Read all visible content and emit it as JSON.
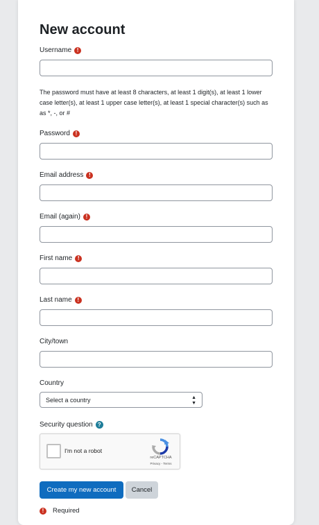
{
  "page": {
    "title": "New account",
    "password_hint": "The password must have at least 8 characters, at least 1 digit(s), at least 1 lower case letter(s), at least 1 upper case letter(s), at least 1 special character(s) such as as *, -, or #"
  },
  "fields": {
    "username": {
      "label": "Username",
      "value": ""
    },
    "password": {
      "label": "Password",
      "value": ""
    },
    "email": {
      "label": "Email address",
      "value": ""
    },
    "email_again": {
      "label": "Email (again)",
      "value": ""
    },
    "first_name": {
      "label": "First name",
      "value": ""
    },
    "last_name": {
      "label": "Last name",
      "value": ""
    },
    "city": {
      "label": "City/town",
      "value": ""
    },
    "country": {
      "label": "Country",
      "selected": "Select a country"
    }
  },
  "security": {
    "label": "Security question",
    "captcha_text": "I'm not a robot",
    "captcha_brand": "reCAPTCHA",
    "captcha_links": "Privacy - Terms"
  },
  "actions": {
    "submit_label": "Create my new account",
    "cancel_label": "Cancel"
  },
  "legend": {
    "required_label": "Required"
  },
  "colors": {
    "primary": "#0f6cbf",
    "required": "#ca3120",
    "help": "#1f7e9a",
    "background": "#e9eaec"
  },
  "icons": {
    "required": "exclamation-circle-icon",
    "help": "question-circle-icon",
    "select": "chevron-updown-icon",
    "captcha": "recaptcha-logo-icon"
  }
}
